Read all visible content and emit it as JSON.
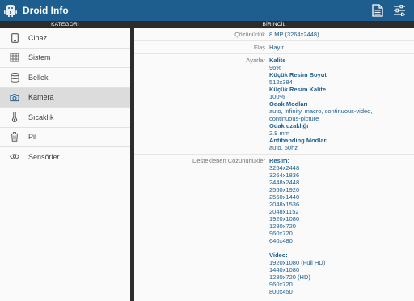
{
  "app": {
    "title": "Droid Info",
    "brand_color": "#1e5e8e"
  },
  "headers": {
    "left": "KATEGORİ",
    "right": "BİRİNCİL"
  },
  "sidebar": {
    "items": [
      {
        "label": "Cihaz",
        "icon": "phone-icon"
      },
      {
        "label": "Sistem",
        "icon": "chip-icon"
      },
      {
        "label": "Bellek",
        "icon": "database-icon"
      },
      {
        "label": "Kamera",
        "icon": "camera-icon",
        "selected": true
      },
      {
        "label": "Sıcaklık",
        "icon": "thermometer-icon"
      },
      {
        "label": "Pil",
        "icon": "trash-icon"
      },
      {
        "label": "Sensörler",
        "icon": "eye-icon"
      }
    ]
  },
  "content": {
    "resolution": {
      "label": "Çözünürlük",
      "value": "8 MP (3264x2448)"
    },
    "flash": {
      "label": "Flaş",
      "value": "Hayır"
    },
    "settings": {
      "label": "Ayarlar",
      "quality_key": "Kalite",
      "quality_val": "96%",
      "thumb_size_key": "Küçük Resim Boyut",
      "thumb_size_val": "512x384",
      "thumb_quality_key": "Küçük Resim Kalite",
      "thumb_quality_val": "100%",
      "focus_modes_key": "Odak Modları",
      "focus_modes_val": "auto, infinity, macro, continuous-video, continuous-picture",
      "focus_dist_key": "Odak uzaklığı",
      "focus_dist_val": "2.9 mm",
      "antibanding_key": "Antibanding Modları",
      "antibanding_val": "auto, 50hz"
    },
    "supported": {
      "label": "Desteklenen Çözünürlükler",
      "picture_key": "Resim:",
      "pictures": [
        "3264x2448",
        "3264x1836",
        "2448x2448",
        "2560x1920",
        "2560x1440",
        "2048x1536",
        "2048x1152",
        "1920x1080",
        "1280x720",
        "960x720",
        "640x480"
      ],
      "video_key": "Video:",
      "videos": [
        "1920x1080 (Full HD)",
        "1440x1080",
        "1280x720 (HD)",
        "960x720",
        "800x450"
      ]
    }
  }
}
